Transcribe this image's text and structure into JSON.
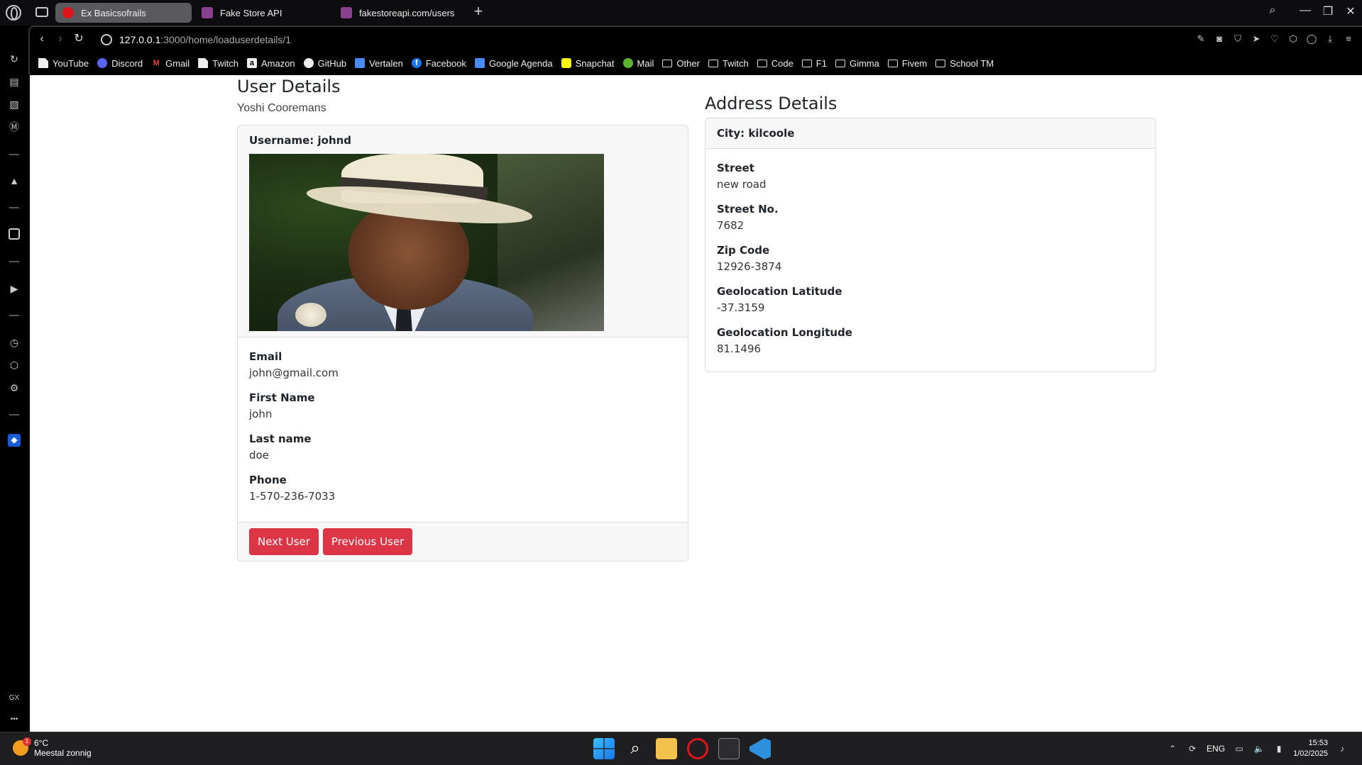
{
  "browser": {
    "tabs": [
      {
        "label": "Ex Basicsofrails"
      },
      {
        "label": "Fake Store API"
      },
      {
        "label": "fakestoreapi.com/users"
      }
    ],
    "url_host": "127.0.0.1",
    "url_path": ":3000/home/loaduserdetails/1",
    "bookmarks": [
      {
        "label": "YouTube"
      },
      {
        "label": "Discord"
      },
      {
        "label": "Gmail"
      },
      {
        "label": "Twitch"
      },
      {
        "label": "Amazon"
      },
      {
        "label": "GitHub"
      },
      {
        "label": "Vertalen"
      },
      {
        "label": "Facebook"
      },
      {
        "label": "Google Agenda"
      },
      {
        "label": "Snapchat"
      },
      {
        "label": "Mail"
      },
      {
        "label": "Other"
      },
      {
        "label": "Twitch"
      },
      {
        "label": "Code"
      },
      {
        "label": "F1"
      },
      {
        "label": "Gimma"
      },
      {
        "label": "Fivem"
      },
      {
        "label": "School TM"
      }
    ],
    "sidebar_gx": "GX",
    "sidebar_more": "•••"
  },
  "page": {
    "user_title": "User Details",
    "author": "Yoshi Cooremans",
    "username_header": "Username: johnd",
    "fields": {
      "email_label": "Email",
      "email_value": "john@gmail.com",
      "first_label": "First Name",
      "first_value": "john",
      "last_label": "Last name",
      "last_value": "doe",
      "phone_label": "Phone",
      "phone_value": "1-570-236-7033"
    },
    "next_button": "Next User",
    "prev_button": "Previous User",
    "address_title": "Address Details",
    "city_header": "City: kilcoole",
    "address": {
      "street_label": "Street",
      "street_value": "new road",
      "number_label": "Street No.",
      "number_value": "7682",
      "zip_label": "Zip Code",
      "zip_value": "12926-3874",
      "lat_label": "Geolocation Latitude",
      "lat_value": "-37.3159",
      "long_label": "Geolocation Longitude",
      "long_value": "81.1496"
    }
  },
  "taskbar": {
    "temperature": "6°C",
    "weather": "Meestal zonnig",
    "weather_badge": "1",
    "language": "ENG",
    "time": "15:53",
    "date": "1/02/2025"
  },
  "colors": {
    "button": "#dc3545",
    "tab_active": "#5a5a5e"
  }
}
